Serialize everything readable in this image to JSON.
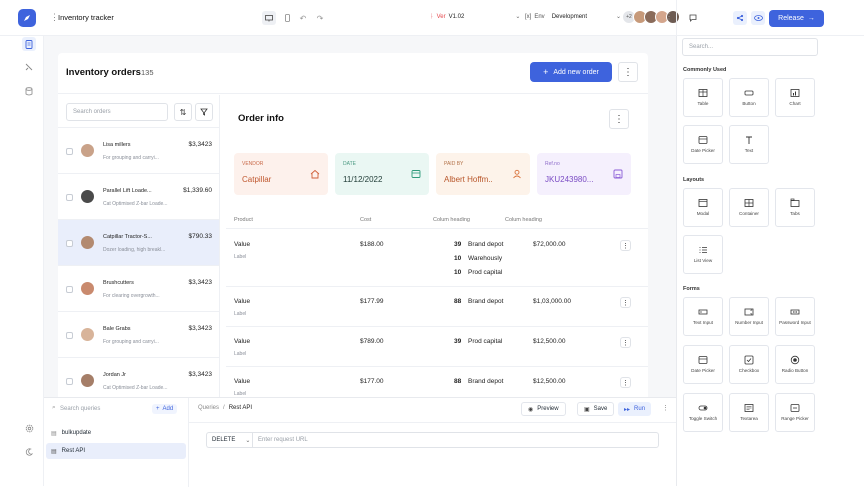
{
  "header": {
    "app_title": "Inventory tracker",
    "version_label": "Ver",
    "version_value": "V1.02",
    "env_label": "Env",
    "env_value": "Development",
    "avatar_more": "+2",
    "release_label": "Release"
  },
  "orders": {
    "title": "Inventory orders",
    "count": "135",
    "search_placeholder": "Search orders",
    "add_label": "Add new order",
    "rows": [
      {
        "name": "Lisa millers",
        "desc": "For grouping and carryi...",
        "price": "$3,3423"
      },
      {
        "name": "Parallel Lift Loade...",
        "desc": "Cat Optimised Z-bar Loade...",
        "price": "$1,339.60"
      },
      {
        "name": "Catpillar Tractor-S...",
        "desc": "Dozer loading, high breakl...",
        "price": "$790.33"
      },
      {
        "name": "Brushcutters",
        "desc": "For clearing overgrowth...",
        "price": "$3,3423"
      },
      {
        "name": "Bale Grabs",
        "desc": "For grouping and carryi...",
        "price": "$3,3423"
      },
      {
        "name": "Jordan Jr",
        "desc": "Cat Optimised Z-bar Loade...",
        "price": "$3,3423"
      }
    ]
  },
  "info": {
    "title": "Order info",
    "cards": [
      {
        "label": "VENDOR",
        "value": "Catpillar"
      },
      {
        "label": "DATE",
        "value": "11/12/2022"
      },
      {
        "label": "PAID BY",
        "value": "Albert Hoffm.."
      },
      {
        "label": "Ref.no",
        "value": "JKU243980..."
      }
    ],
    "columns": [
      "Product",
      "Cost",
      "Colum heading",
      "Colum heading"
    ],
    "rows": [
      {
        "product": "Value",
        "sub": "Label",
        "cost": "$188.00",
        "lines": [
          {
            "n": "39",
            "t": "Brand depot"
          },
          {
            "n": "10",
            "t": "Warehously"
          },
          {
            "n": "10",
            "t": "Prod capital"
          }
        ],
        "total": "$72,000.00"
      },
      {
        "product": "Value",
        "sub": "Label",
        "cost": "$177.99",
        "lines": [
          {
            "n": "88",
            "t": "Brand depot"
          }
        ],
        "total": "$1,03,000.00"
      },
      {
        "product": "Value",
        "sub": "Label",
        "cost": "$789.00",
        "lines": [
          {
            "n": "39",
            "t": "Prod capital"
          }
        ],
        "total": "$12,500.00"
      },
      {
        "product": "Value",
        "sub": "Label",
        "cost": "$177.00",
        "lines": [
          {
            "n": "88",
            "t": "Brand depot"
          }
        ],
        "total": "$12,500.00"
      }
    ]
  },
  "queries": {
    "search_placeholder": "Search queries",
    "add_label": "Add",
    "items": [
      "bulkupdate",
      "Rest API"
    ],
    "breadcrumb_root": "Queries",
    "breadcrumb_sep": "/",
    "breadcrumb_current": "Rest API",
    "preview_label": "Preview",
    "save_label": "Save",
    "run_label": "Run",
    "method": "DELETE",
    "url_placeholder": "Enter request URL"
  },
  "widgets": {
    "search_placeholder": "Search...",
    "sections": [
      {
        "title": "Commonly Used",
        "items": [
          "Table",
          "Button",
          "Chart",
          "Date Picker",
          "Text"
        ]
      },
      {
        "title": "Layouts",
        "items": [
          "Modal",
          "Container",
          "Tabs",
          "List View"
        ]
      },
      {
        "title": "Forms",
        "items": [
          "Text Input",
          "Number Input",
          "Password Input",
          "Date Picker",
          "Checkbox",
          "Radio Button",
          "Toggle Switch",
          "Textarea",
          "Range Picker"
        ]
      }
    ]
  },
  "colors": {
    "accent": "#3e63dd",
    "vendor_bg": "#fdf1ec",
    "date_bg": "#eaf7f3",
    "paid_bg": "#fdf3ea",
    "ref_bg": "#f5f0fd"
  }
}
